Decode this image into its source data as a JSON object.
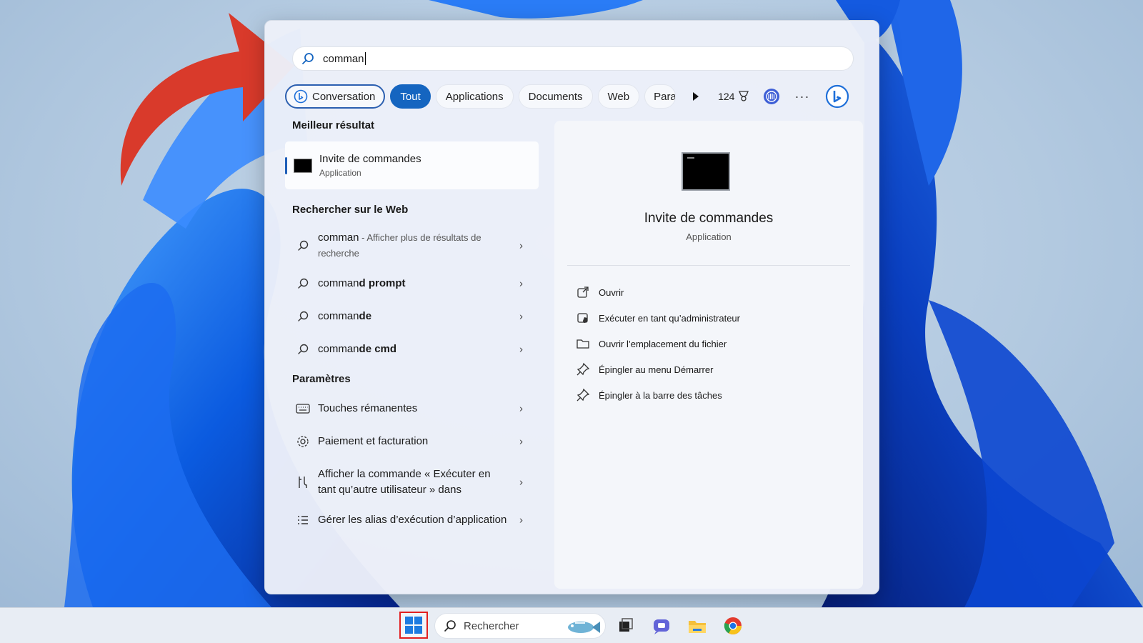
{
  "search": {
    "query": "comman"
  },
  "filters": {
    "conversation": "Conversation",
    "tout": "Tout",
    "applications": "Applications",
    "documents": "Documents",
    "web": "Web",
    "para": "Para",
    "points": "124"
  },
  "left": {
    "best_title": "Meilleur résultat",
    "best_item": {
      "name_pre": "Invite de comman",
      "name_post": "des",
      "type": "Application"
    },
    "web_title": "Rechercher sur le Web",
    "web_items": [
      {
        "main": "comman",
        "sub": " - Afficher plus de résultats de recherche"
      },
      {
        "pre": "comman",
        "bold": "d prompt"
      },
      {
        "pre": "comman",
        "bold": "de"
      },
      {
        "pre": "comman",
        "bold": "de cmd"
      }
    ],
    "settings_title": "Paramètres",
    "settings_items": [
      {
        "label": "Touches rémanentes"
      },
      {
        "label": "Paiement et facturation"
      },
      {
        "pre": "Afficher la ",
        "bold": "comman",
        "post": "de « Exécuter en tant qu’autre utilisateur » dans"
      },
      {
        "label": "Gérer les alias d’exécution d’application"
      }
    ]
  },
  "right": {
    "title": "Invite de commandes",
    "subtitle": "Application",
    "actions": [
      {
        "label": "Ouvrir",
        "icon": "open-external-icon"
      },
      {
        "label": "Exécuter en tant qu’administrateur",
        "icon": "admin-shield-icon"
      },
      {
        "label": "Ouvrir l’emplacement du fichier",
        "icon": "folder-icon"
      },
      {
        "label": "Épingler au menu Démarrer",
        "icon": "pin-icon"
      },
      {
        "label": "Épingler à la barre des tâches",
        "icon": "pin-icon"
      }
    ]
  },
  "taskbar": {
    "search_placeholder": "Rechercher"
  },
  "colors": {
    "accent": "#1565c0",
    "arrow": "#d93a2b",
    "highlight_border": "#e22020"
  }
}
